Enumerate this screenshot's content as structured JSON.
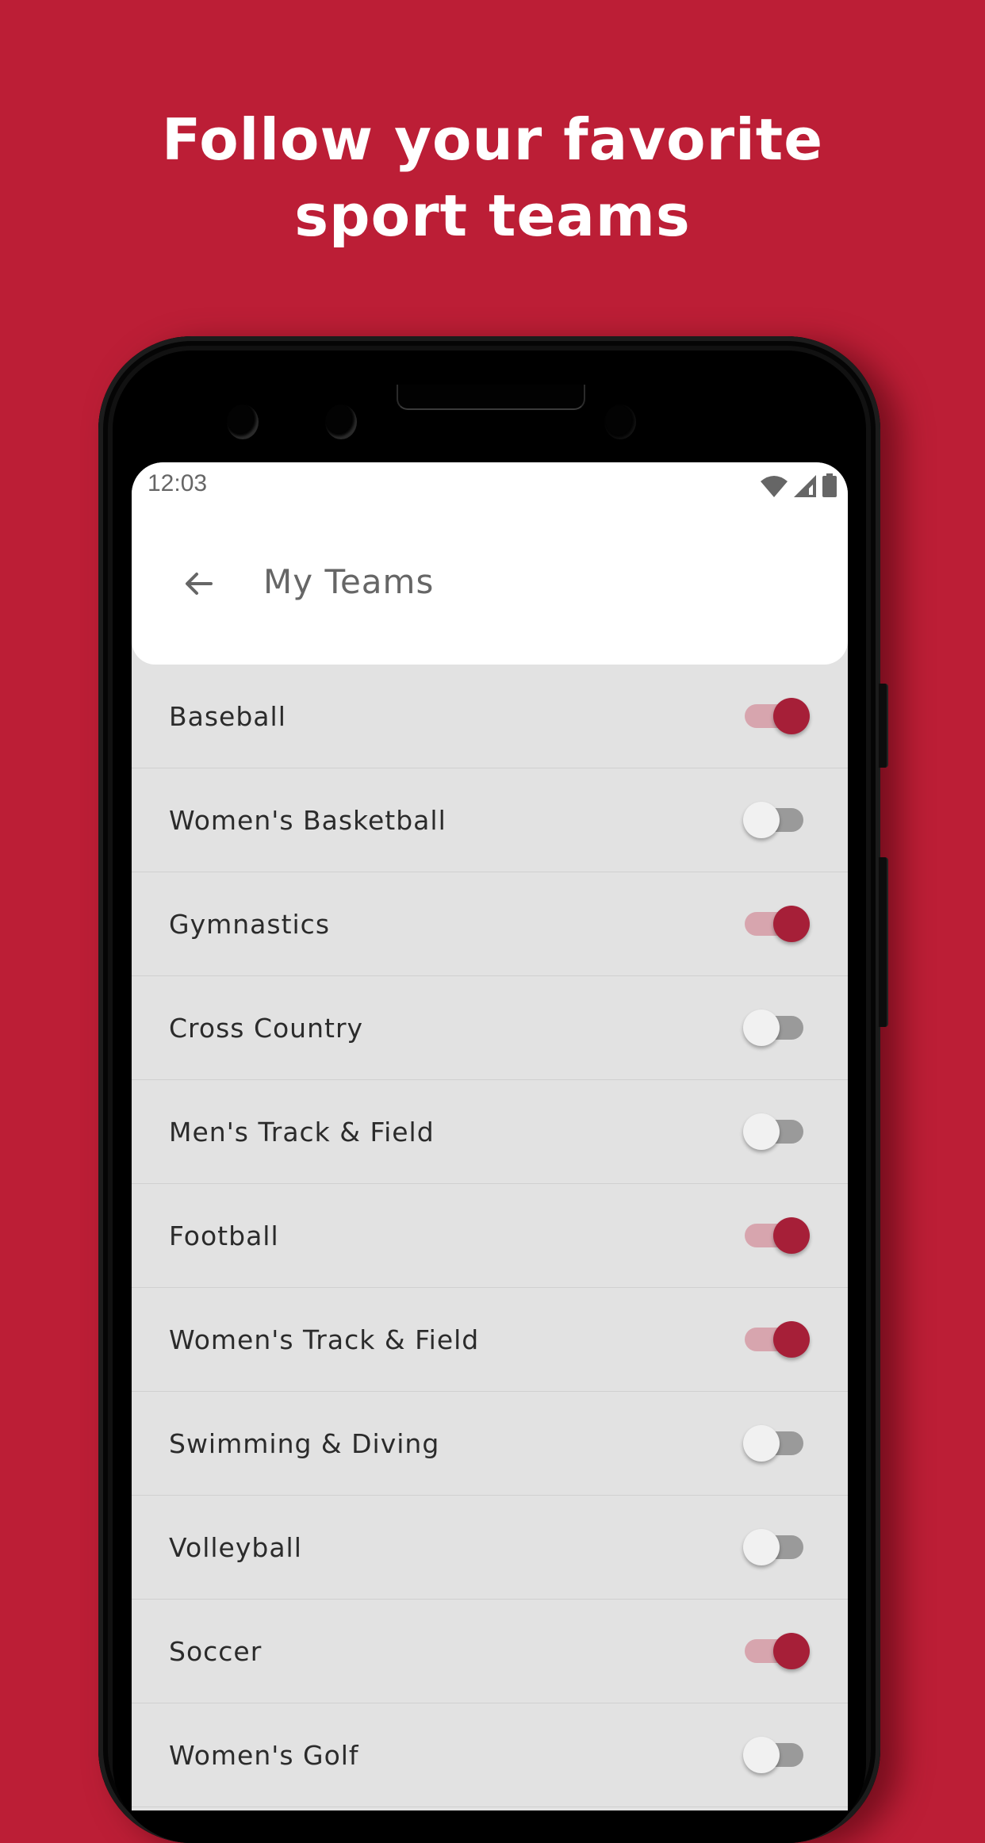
{
  "headline": {
    "line1": "Follow your favorite",
    "line2": "sport teams"
  },
  "colors": {
    "brand": "#bc1e36",
    "toggle_on": "#a61f38",
    "toggle_on_track": "#d7a5ae",
    "toggle_off_thumb": "#f1f1f1",
    "toggle_off_track": "#9a9a9a"
  },
  "status_bar": {
    "time": "12:03",
    "icons": [
      "wifi-icon",
      "signal-icon",
      "battery-icon"
    ]
  },
  "app_bar": {
    "back_icon": "arrow-left-icon",
    "title": "My Teams"
  },
  "teams": [
    {
      "label": "Baseball",
      "following": true
    },
    {
      "label": "Women's Basketball",
      "following": false
    },
    {
      "label": "Gymnastics",
      "following": true
    },
    {
      "label": "Cross Country",
      "following": false
    },
    {
      "label": "Men's Track & Field",
      "following": false
    },
    {
      "label": "Football",
      "following": true
    },
    {
      "label": "Women's Track & Field",
      "following": true
    },
    {
      "label": "Swimming & Diving",
      "following": false
    },
    {
      "label": "Volleyball",
      "following": false
    },
    {
      "label": "Soccer",
      "following": true
    },
    {
      "label": "Women's Golf",
      "following": false
    }
  ]
}
